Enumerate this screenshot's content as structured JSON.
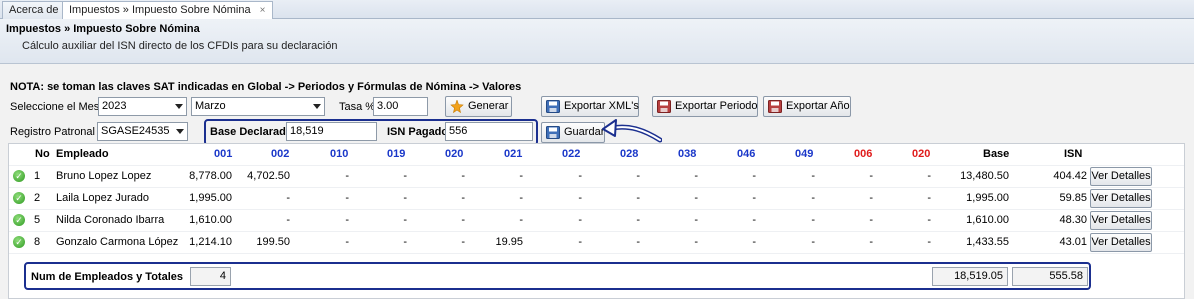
{
  "tabs": [
    {
      "label": "Acerca de"
    },
    {
      "label": "Impuestos » Impuesto Sobre Nómina",
      "close": "×"
    }
  ],
  "header": {
    "title": "Impuestos » Impuesto Sobre Nómina",
    "subtitle": "Cálculo auxiliar del ISN directo de los CFDIs para su declaración"
  },
  "note": "NOTA: se toman las claves SAT indicadas en Global -> Periodos y Fórmulas de Nómina -> Valores",
  "controls": {
    "mes_label": "Seleccione el Mes",
    "year": "2023",
    "month": "Marzo",
    "tasa_label": "Tasa %",
    "tasa": "3.00",
    "generar": "Generar",
    "exportar_xml": "Exportar XML's",
    "exportar_periodo": "Exportar Periodo",
    "exportar_anio": "Exportar Año",
    "registro_label": "Registro Patronal",
    "registro": "SGASE24535",
    "base_label": "Base Declarada",
    "base": "18,519",
    "isn_label": "ISN Pagado",
    "isn": "556",
    "guardar": "Guardar"
  },
  "table": {
    "headers": {
      "no": "No",
      "empleado": "Empleado",
      "codes": [
        "001",
        "002",
        "010",
        "019",
        "020",
        "021",
        "022",
        "028",
        "038",
        "046",
        "049",
        "006",
        "020"
      ],
      "base": "Base",
      "isn": "ISN"
    },
    "rows": [
      {
        "no": "1",
        "empleado": "Bruno Lopez Lopez",
        "vals": [
          "8,778.00",
          "4,702.50",
          "-",
          "-",
          "-",
          "-",
          "-",
          "-",
          "-",
          "-",
          "-",
          "-",
          "-"
        ],
        "base": "13,480.50",
        "isn": "404.42",
        "action": "Ver Detalles"
      },
      {
        "no": "2",
        "empleado": "Laila Lopez Jurado",
        "vals": [
          "1,995.00",
          "-",
          "-",
          "-",
          "-",
          "-",
          "-",
          "-",
          "-",
          "-",
          "-",
          "-",
          "-"
        ],
        "base": "1,995.00",
        "isn": "59.85",
        "action": "Ver Detalles"
      },
      {
        "no": "5",
        "empleado": "Nilda Coronado Ibarra",
        "vals": [
          "1,610.00",
          "-",
          "-",
          "-",
          "-",
          "-",
          "-",
          "-",
          "-",
          "-",
          "-",
          "-",
          "-"
        ],
        "base": "1,610.00",
        "isn": "48.30",
        "action": "Ver Detalles"
      },
      {
        "no": "8",
        "empleado": "Gonzalo Carmona López",
        "vals": [
          "1,214.10",
          "199.50",
          "-",
          "-",
          "-",
          "19.95",
          "-",
          "-",
          "-",
          "-",
          "-",
          "-",
          "-"
        ],
        "base": "1,433.55",
        "isn": "43.01",
        "action": "Ver Detalles"
      }
    ],
    "totals": {
      "label": "Num de Empleados y Totales",
      "count": "4",
      "base": "18,519.05",
      "isn": "555.58"
    }
  },
  "colors": {
    "code_header_blue": "#1a37c9",
    "code_header_red": "#e01b1b",
    "highlight_border": "#1b2f8f"
  }
}
